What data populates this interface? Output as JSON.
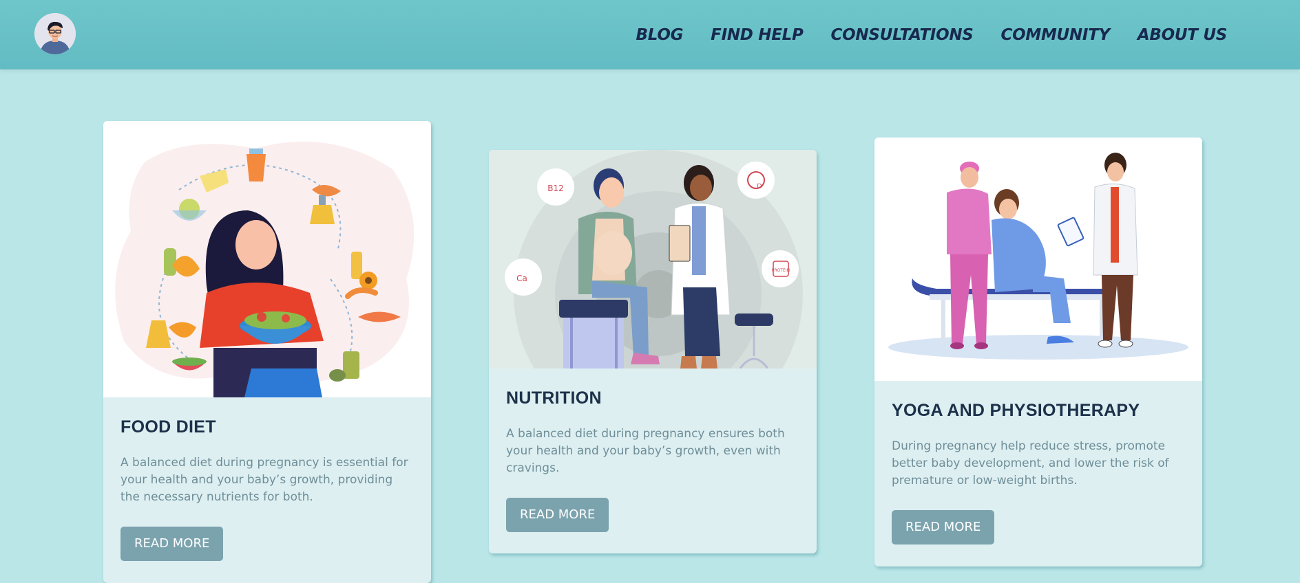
{
  "nav": {
    "links": [
      "BLOG",
      "FIND HELP",
      "CONSULTATIONS",
      "COMMUNITY",
      "ABOUT US"
    ]
  },
  "cards": [
    {
      "title": "FOOD DIET",
      "description": "A balanced diet during pregnancy is essential for your health and your baby’s growth, providing the necessary nutrients for both.",
      "button": "READ MORE"
    },
    {
      "title": "NUTRITION",
      "description": "A balanced diet during pregnancy ensures both your health and your baby’s growth, even with cravings.",
      "button": "READ MORE"
    },
    {
      "title": "YOGA AND PHYSIOTHERAPY",
      "description": "During pregnancy help reduce stress, promote better baby development, and lower the risk of premature or low-weight births.",
      "button": "READ MORE"
    }
  ],
  "illustration_badges": [
    "B12",
    "Ca",
    "D",
    "PROTEIN"
  ],
  "colors": {
    "page_bg": "#bae6e8",
    "navbar": "#68c1c6",
    "nav_text": "#18294f",
    "card_bg": "#ddeff1",
    "button": "#7ba3ae",
    "title": "#1c3149",
    "body_text": "#6f8e98"
  }
}
